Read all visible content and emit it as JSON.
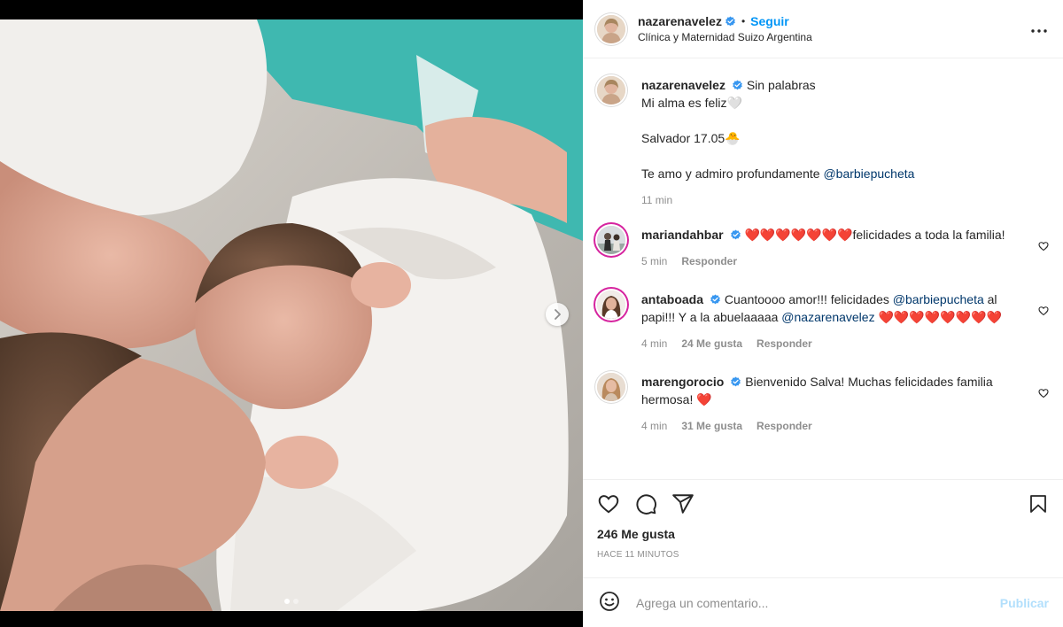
{
  "post": {
    "author": "nazarenavelez",
    "follow_label": "Seguir",
    "bullet": "•",
    "location": "Clínica y Maternidad Suizo Argentina",
    "more_icon": "more-horizontal-icon",
    "carousel": {
      "current": 1,
      "total": 2
    }
  },
  "caption": {
    "username": "nazarenavelez",
    "text_before": "Sin palabras\nMi alma es feliz🤍\n\nSalvador 17.05🐣\n\nTe amo y admiro profundamente ",
    "mention": "@barbiepucheta",
    "time": "11 min"
  },
  "comments": [
    {
      "username": "mariandahbar",
      "text": "❤️❤️❤️❤️❤️❤️❤️felicidades a toda la familia!",
      "time": "5 min",
      "likes": "",
      "reply_label": "Responder"
    },
    {
      "username": "antaboada",
      "text_a": "Cuantoooo amor!!! felicidades ",
      "mention_a": "@barbiepucheta",
      "text_b": " al papi!!! Y a la abuelaaaaa ",
      "mention_b": "@nazarenavelez",
      "text_c": " ❤️❤️❤️❤️❤️❤️❤️❤️",
      "time": "4 min",
      "likes": "24 Me gusta",
      "reply_label": "Responder"
    },
    {
      "username": "marengorocio",
      "text": "Bienvenido Salva! Muchas felicidades familia hermosa! ❤️",
      "time": "4 min",
      "likes": "31 Me gusta",
      "reply_label": "Responder"
    }
  ],
  "actions": {
    "like_icon": "heart-outline-icon",
    "comment_icon": "comment-icon",
    "share_icon": "send-icon",
    "save_icon": "bookmark-icon",
    "likes_count": "246 Me gusta",
    "posted_ago": "HACE 11 MINUTOS"
  },
  "composer": {
    "placeholder": "Agrega un comentario...",
    "publish_label": "Publicar"
  },
  "colors": {
    "accent": "#0095f6",
    "verified": "#3897f0",
    "publish_disabled": "#b2dffc",
    "mention": "#00376b",
    "muted": "#8e8e8e"
  }
}
